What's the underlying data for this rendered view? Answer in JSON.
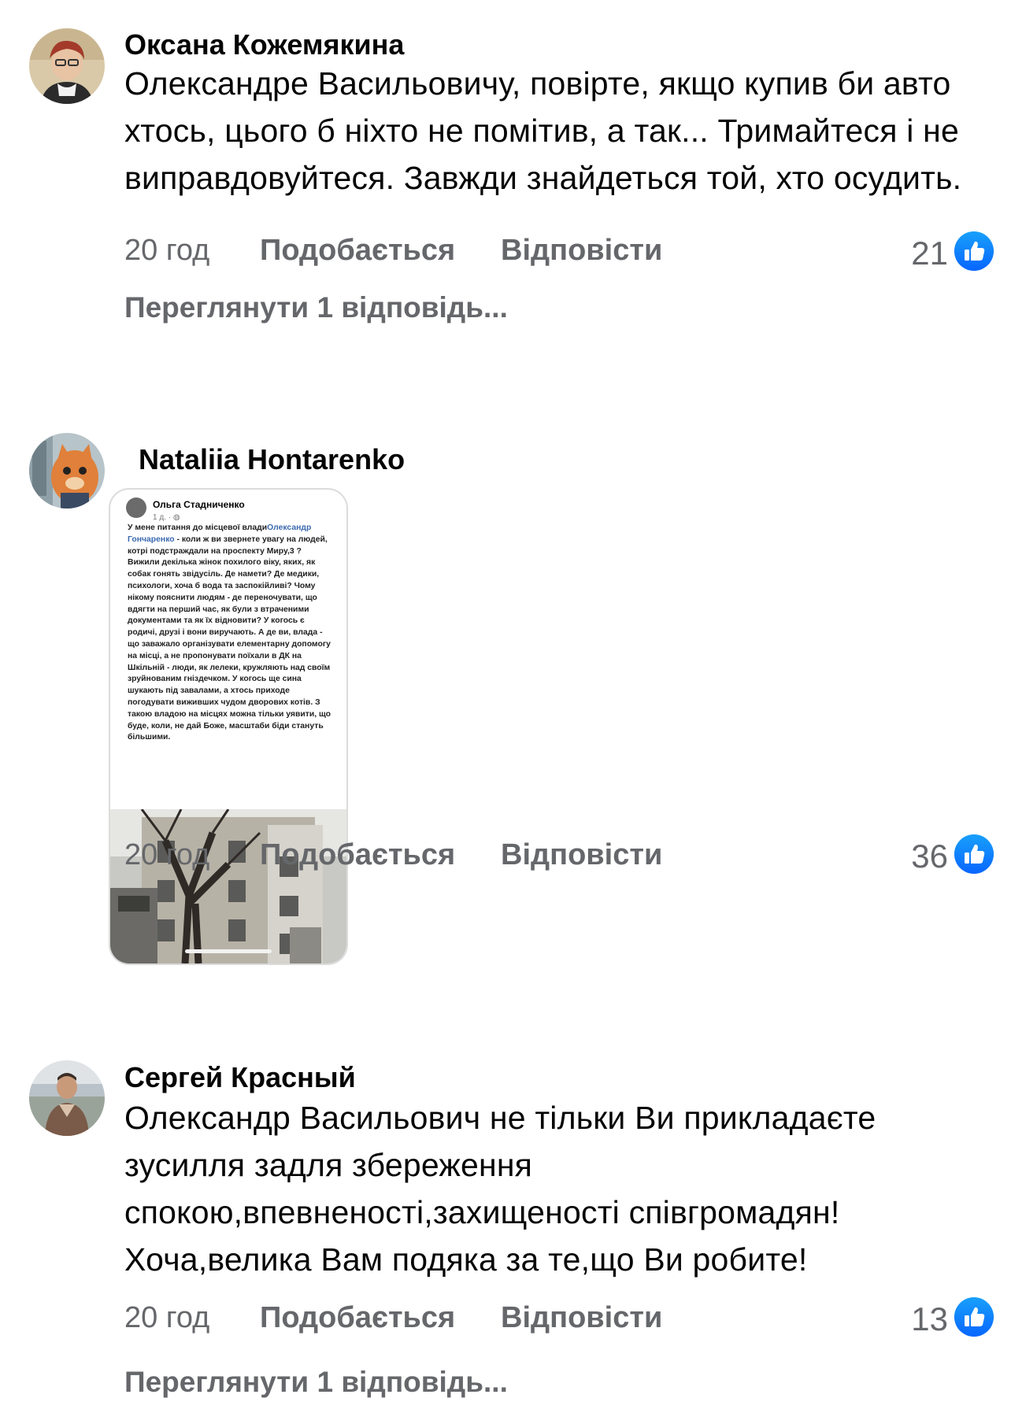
{
  "comments": [
    {
      "author": "Оксана Кожемякина",
      "text": "Олександре Васильовичу, повірте, якщо купив би авто хтось, цього б ніхто не помітив, а так... Тримайтеся і не виправдовуйтеся. Завжди знайдеться той, хто осудить.",
      "time": "20 год",
      "like_label": "Подобається",
      "reply_label": "Відповісти",
      "reaction_count": "21",
      "view_replies": "Переглянути 1 відповідь..."
    },
    {
      "author": "Nataliia Hontarenko",
      "time": "20 год",
      "like_label": "Подобається",
      "reply_label": "Відповісти",
      "reaction_count": "36",
      "attachment": {
        "author": "Ольга Стадниченко",
        "meta": "1 д. · ",
        "text_before_mention": "У мене питання до місцевої влади",
        "mention": "Олександр Гончаренко",
        "text_after_mention": " - коли ж ви звернете увагу на людей, котрі подстраждали на проспекту Миру,3 ? Вижили декілька жінок похилого віку, яких, як собак гонять звідусіль. Де намети? Де медики, психологи, хоча б вода та заспокійливі? Чому нікому пояснити людям - де переночувати, що вдягти на перший час, як були з втраченими документами та як їх відновити? У когось є родичі, друзі і вони виручають. А де ви, влада - що заважало організувати елементарну допомогу на місці, а не пропонувати поїхали в ДК на Шкільній - люди, як лелеки, кружляють над своїм зруйнованим гніздечком. У когось ще сина шукають під завалами, а хтось приходе погодувати виживших чудом дворових котів. З такою владою на місцях можна тільки уявити, що буде, коли, не дай Боже, масштаби біди стануть більшими."
      }
    },
    {
      "author": "Сергей Красный",
      "text": "Олександр Васильович не тільки Ви прикладаєте зусилля задля збереження спокою,впевненості,захищеності співгромадян! Хоча,велика Вам подяка за те,що Ви робите!",
      "time": "20 год",
      "like_label": "Подобається",
      "reply_label": "Відповісти",
      "reaction_count": "13",
      "view_replies": "Переглянути 1 відповідь..."
    }
  ],
  "colors": {
    "secondary_text": "#65676b",
    "like_blue": "#0866ff",
    "mention_blue": "#3b69b0"
  },
  "icons": [
    "like-reaction-icon",
    "avatar"
  ]
}
